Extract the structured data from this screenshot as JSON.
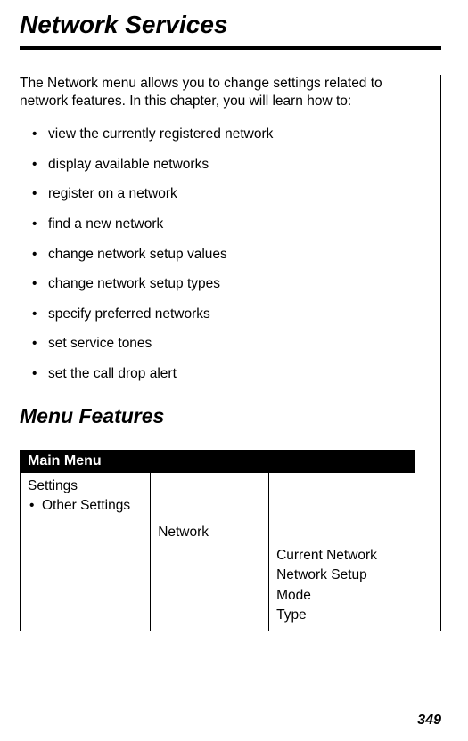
{
  "title": "Network Services",
  "intro": "The Network menu allows you to change settings related to network features. In this chapter, you will learn how to:",
  "bullets": [
    "view the currently registered network",
    "display available networks",
    "register on a network",
    "find a new network",
    "change network setup values",
    "change network setup types",
    "specify preferred networks",
    "set service tones",
    "set the call drop alert"
  ],
  "section_heading": "Menu Features",
  "table": {
    "header": "Main Menu",
    "col1_line1": "Settings",
    "col1_sub": "Other Settings",
    "col2": "Network",
    "col3_items": [
      "Current Network",
      "Network Setup",
      "Mode",
      "Type"
    ]
  },
  "page_number": "349"
}
